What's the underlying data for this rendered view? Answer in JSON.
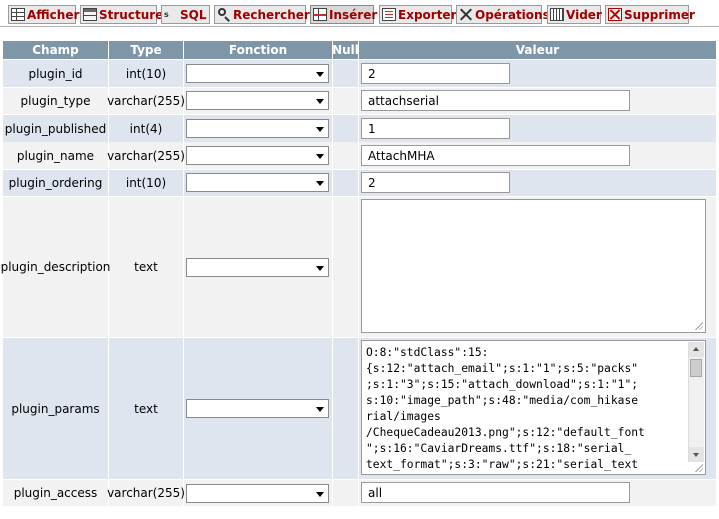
{
  "tabs": [
    {
      "label": "Afficher",
      "icon": "browse-icon"
    },
    {
      "label": "Structure",
      "icon": "structure-icon"
    },
    {
      "label": "SQL",
      "icon": "sql-icon"
    },
    {
      "label": "Rechercher",
      "icon": "search-icon"
    },
    {
      "label": "Insérer",
      "icon": "insert-icon"
    },
    {
      "label": "Exporter",
      "icon": "export-icon"
    },
    {
      "label": "Opérations",
      "icon": "operations-icon"
    },
    {
      "label": "Vider",
      "icon": "empty-icon"
    },
    {
      "label": "Supprimer",
      "icon": "delete-icon"
    }
  ],
  "active_tab": "Insérer",
  "columns": {
    "champ": "Champ",
    "type": "Type",
    "fonction": "Fonction",
    "null": "Null",
    "valeur": "Valeur"
  },
  "rows": [
    {
      "champ": "plugin_id",
      "type": "int(10)",
      "fonction": "",
      "valeur": "2"
    },
    {
      "champ": "plugin_type",
      "type": "varchar(255)",
      "fonction": "",
      "valeur": "attachserial"
    },
    {
      "champ": "plugin_published",
      "type": "int(4)",
      "fonction": "",
      "valeur": "1"
    },
    {
      "champ": "plugin_name",
      "type": "varchar(255)",
      "fonction": "",
      "valeur": "AttachMHA"
    },
    {
      "champ": "plugin_ordering",
      "type": "int(10)",
      "fonction": "",
      "valeur": "2"
    },
    {
      "champ": "plugin_description",
      "type": "text",
      "fonction": "",
      "valeur": ""
    },
    {
      "champ": "plugin_params",
      "type": "text",
      "fonction": "",
      "valeur": "O:8:\"stdClass\":15:\n{s:12:\"attach_email\";s:1:\"1\";s:5:\"packs\"\n;s:1:\"3\";s:15:\"attach_download\";s:1:\"1\";\ns:10:\"image_path\";s:48:\"media/com_hikase\nrial/images\n/ChequeCadeau2013.png\";s:12:\"default_font\n\";s:16:\"CaviarDreams.ttf\";s:18:\"serial_\ntext_format\";s:3:\"raw\";s:21:\"serial_text"
    },
    {
      "champ": "plugin_access",
      "type": "varchar(255)",
      "fonction": "",
      "valeur": "all"
    }
  ],
  "colors": {
    "header_bg": "#7f96a8",
    "row_odd": "#dfe5ee",
    "row_even": "#f2f2f2",
    "tab_text": "#a00000"
  }
}
